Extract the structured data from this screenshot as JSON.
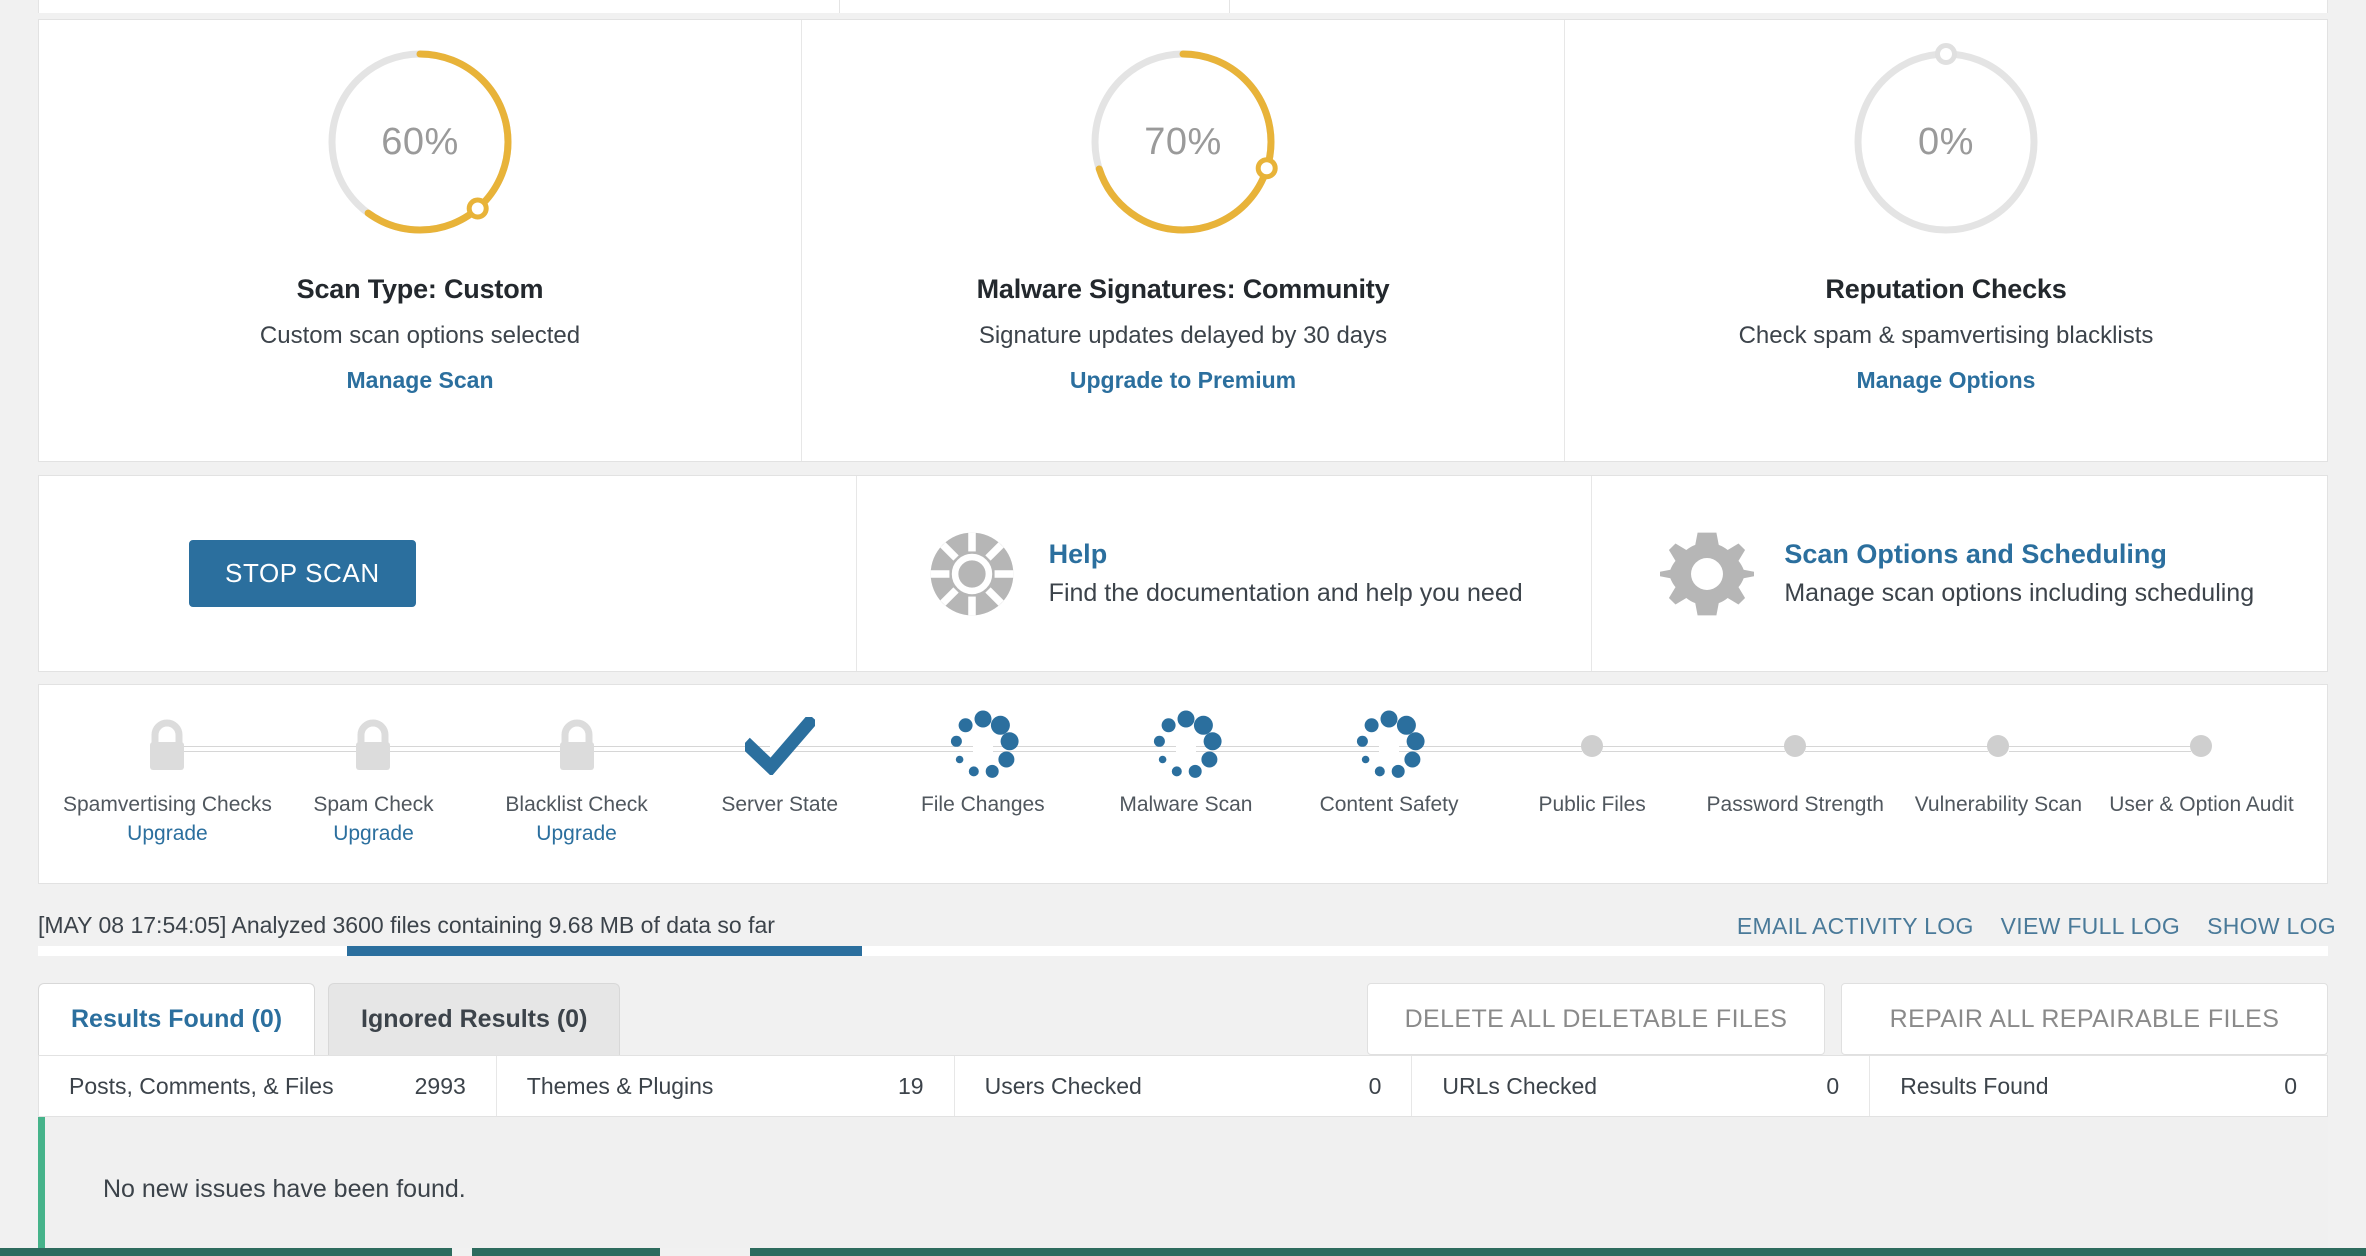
{
  "gauges": [
    {
      "percent": 60,
      "percent_label": "60%",
      "title": "Scan Type: Custom",
      "subtitle": "Custom scan options selected",
      "link": "Manage Scan",
      "color": "#e8b339"
    },
    {
      "percent": 70,
      "percent_label": "70%",
      "title": "Malware Signatures: Community",
      "subtitle": "Signature updates delayed by 30 days",
      "link": "Upgrade to Premium",
      "color": "#e8b339"
    },
    {
      "percent": 0,
      "percent_label": "0%",
      "title": "Reputation Checks",
      "subtitle": "Check spam & spamvertising blacklists",
      "link": "Manage Options",
      "color": "#e0e0e0"
    }
  ],
  "actions": {
    "stop_scan_label": "STOP SCAN",
    "help": {
      "icon": "lifebuoy-icon",
      "title": "Help",
      "subtitle": "Find the documentation and help you need"
    },
    "scan_options": {
      "icon": "gear-icon",
      "title": "Scan Options and Scheduling",
      "subtitle": "Manage scan options including scheduling"
    }
  },
  "steps": [
    {
      "label": "Spamvertising Checks",
      "state": "locked",
      "icon": "lock-icon",
      "upgrade": "Upgrade"
    },
    {
      "label": "Spam Check",
      "state": "locked",
      "icon": "lock-icon",
      "upgrade": "Upgrade"
    },
    {
      "label": "Blacklist Check",
      "state": "locked",
      "icon": "lock-icon",
      "upgrade": "Upgrade"
    },
    {
      "label": "Server State",
      "state": "done",
      "icon": "check-icon",
      "upgrade": ""
    },
    {
      "label": "File Changes",
      "state": "running",
      "icon": "spinner-icon",
      "upgrade": ""
    },
    {
      "label": "Malware Scan",
      "state": "running",
      "icon": "spinner-icon",
      "upgrade": ""
    },
    {
      "label": "Content Safety",
      "state": "running",
      "icon": "spinner-icon",
      "upgrade": ""
    },
    {
      "label": "Public Files",
      "state": "pending",
      "icon": "dot-icon",
      "upgrade": ""
    },
    {
      "label": "Password Strength",
      "state": "pending",
      "icon": "dot-icon",
      "upgrade": ""
    },
    {
      "label": "Vulnerability Scan",
      "state": "pending",
      "icon": "dot-icon",
      "upgrade": ""
    },
    {
      "label": "User & Option Audit",
      "state": "pending",
      "icon": "dot-icon",
      "upgrade": ""
    }
  ],
  "log": {
    "status_text": "[MAY 08 17:54:05] Analyzed 3600 files containing 9.68 MB of data so far",
    "links": [
      "EMAIL ACTIVITY LOG",
      "VIEW FULL LOG",
      "SHOW LOG"
    ],
    "progress_start_percent": 13.5,
    "progress_end_percent": 36.0
  },
  "tabs": [
    {
      "label": "Results Found (0)",
      "active": true
    },
    {
      "label": "Ignored Results (0)",
      "active": false
    }
  ],
  "bulk_buttons": [
    {
      "label": "DELETE ALL DELETABLE FILES"
    },
    {
      "label": "REPAIR ALL REPAIRABLE FILES"
    }
  ],
  "stats": [
    {
      "label": "Posts, Comments, & Files",
      "value": "2993"
    },
    {
      "label": "Themes & Plugins",
      "value": "19"
    },
    {
      "label": "Users Checked",
      "value": "0"
    },
    {
      "label": "URLs Checked",
      "value": "0"
    },
    {
      "label": "Results Found",
      "value": "0"
    }
  ],
  "notice": {
    "text": "No new issues have been found.",
    "accent_color": "#46b38a"
  },
  "colors": {
    "accent_blue": "#2b6f9e",
    "gauge_amber": "#e8b339",
    "track_grey": "#e0e0e0"
  }
}
